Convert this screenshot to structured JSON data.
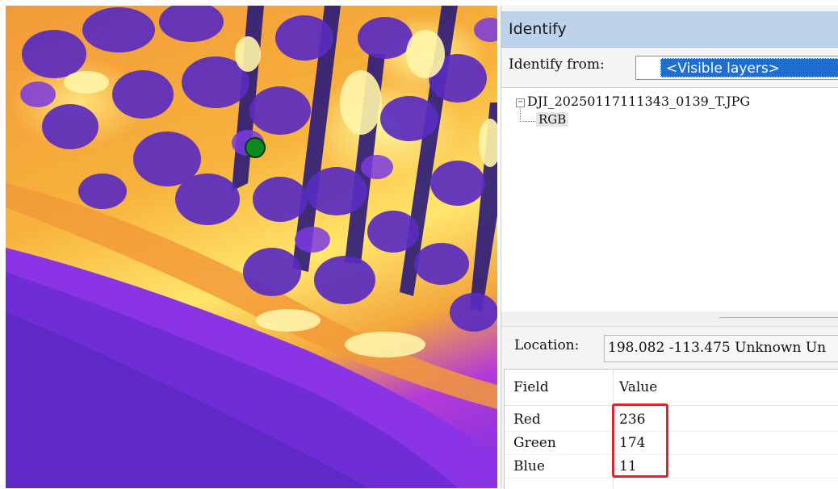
{
  "identify": {
    "title": "Identify",
    "from_label": "Identify from:",
    "from_value": "<Visible layers>",
    "tree": {
      "root": "DJI_20250117111343_0139_T.JPG",
      "child": "RGB"
    },
    "location": {
      "label": "Location:",
      "value": "198.082  -113.475 Unknown Un"
    },
    "table": {
      "headers": [
        "Field",
        "Value"
      ],
      "rows": [
        {
          "field": "Red",
          "value": "236"
        },
        {
          "field": "Green",
          "value": "174"
        },
        {
          "field": "Blue",
          "value": "11"
        }
      ]
    }
  },
  "colors": {
    "title_bar": "#bcd3ea",
    "selection": "#1e6fd0",
    "marker": "#0c8a1f",
    "highlight_box": "#e0242a"
  },
  "map": {
    "marker_icon": "green-circle-marker"
  }
}
